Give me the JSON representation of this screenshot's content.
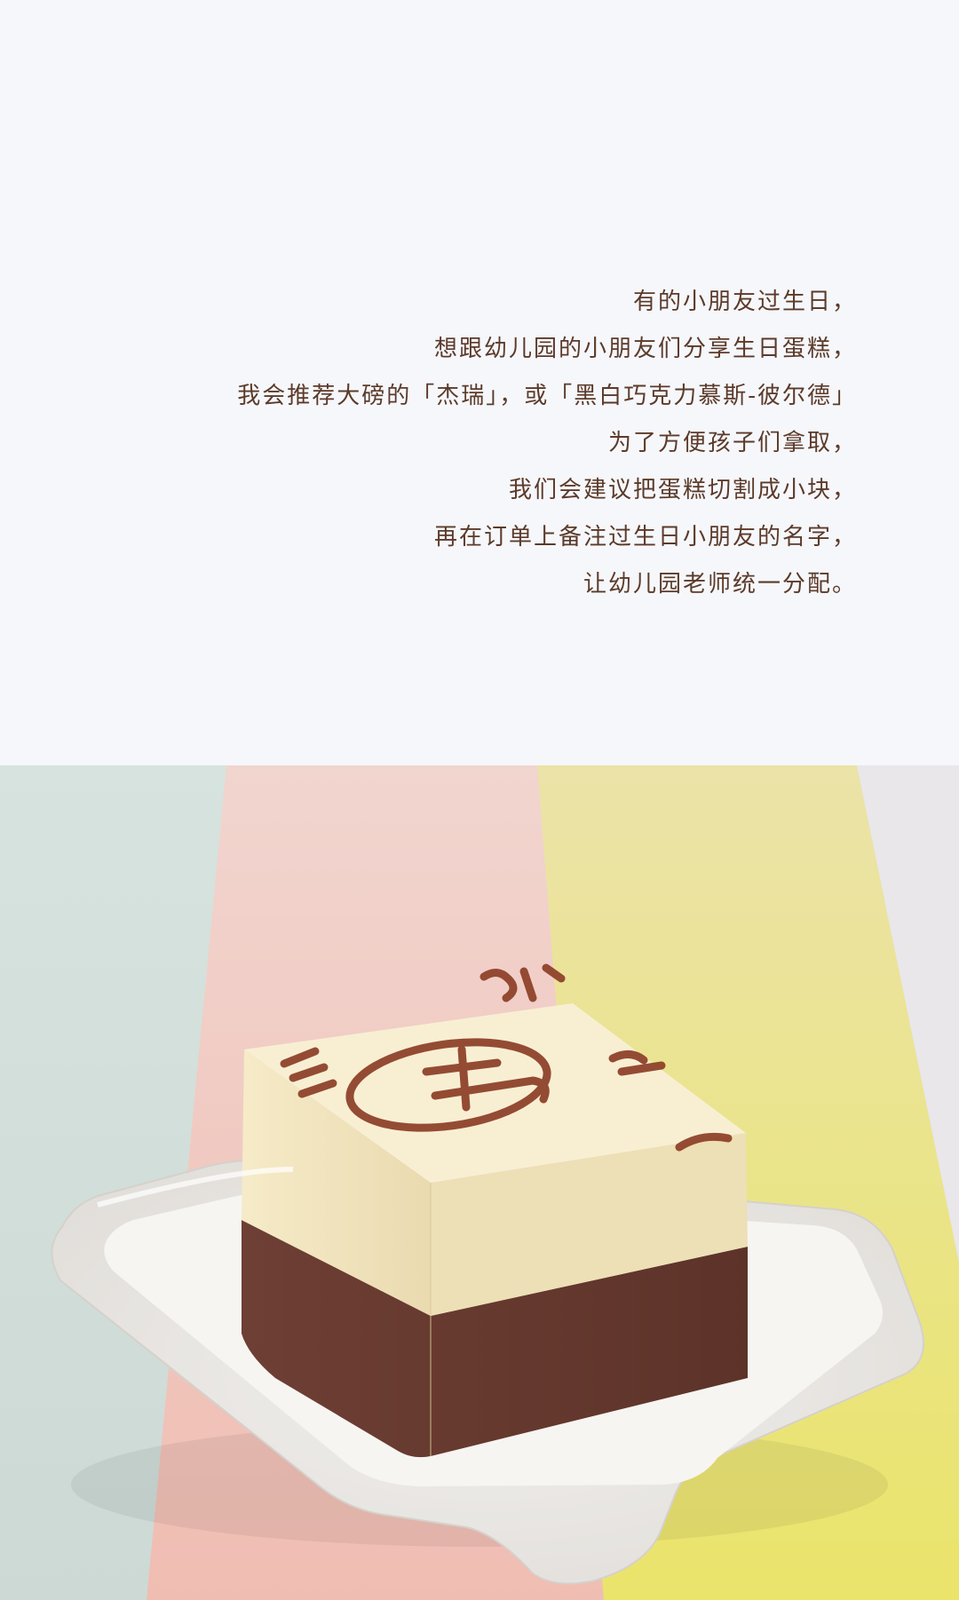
{
  "story": {
    "lines": [
      "有的小朋友过生日，",
      "想跟幼儿园的小朋友们分享生日蛋糕，",
      "我会推荐大磅的「杰瑞」，或「黑白巧克力慕斯-彼尔德」",
      "为了方便孩子们拿取，",
      "我们会建议把蛋糕切割成小块，",
      "再在订单上备注过生日小朋友的名字，",
      "让幼儿园老师统一分配。"
    ]
  },
  "photo": {
    "subject": "cake-slice-on-paper-tray",
    "colors": {
      "text": "#5c3a2a",
      "page_background": "#f5f7fa",
      "mint_stripe": "#d6e3de",
      "pink_stripe": "#f0d2cc",
      "yellow_stripe": "#ebe58f",
      "cream": "#f2e8c6",
      "chocolate": "#6b3d33",
      "cocoa_print": "#8c3e26"
    }
  }
}
